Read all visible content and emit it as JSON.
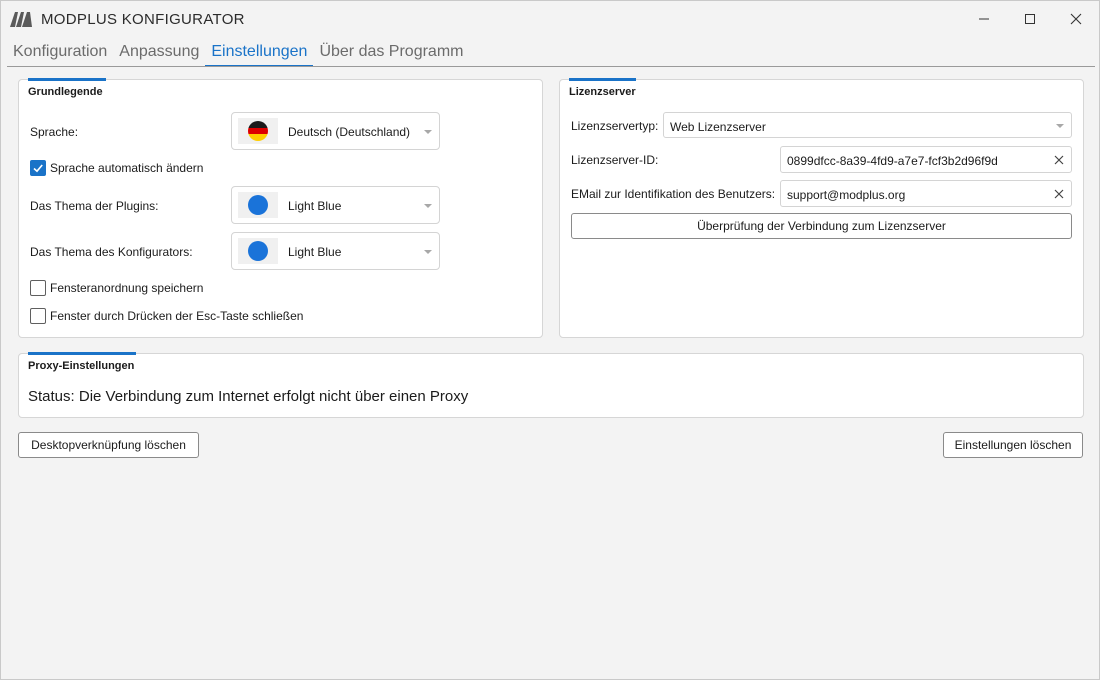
{
  "app": {
    "title": "MODPLUS KONFIGURATOR"
  },
  "tabs": [
    {
      "label": "Konfiguration"
    },
    {
      "label": "Anpassung"
    },
    {
      "label": "Einstellungen",
      "active": true
    },
    {
      "label": "Über das Programm"
    }
  ],
  "general": {
    "title": "Grundlegende",
    "language_label": "Sprache:",
    "language_value": "Deutsch (Deutschland)",
    "auto_language_label": "Sprache automatisch ändern",
    "auto_language_checked": true,
    "plugin_theme_label": "Das Thema der Plugins:",
    "plugin_theme_value": "Light Blue",
    "config_theme_label": "Das Thema des Konfigurators:",
    "config_theme_value": "Light Blue",
    "save_window_label": "Fensteranordnung speichern",
    "save_window_checked": false,
    "esc_close_label": "Fenster durch Drücken der Esc-Taste schließen",
    "esc_close_checked": false
  },
  "license": {
    "title": "Lizenzserver",
    "type_label": "Lizenzservertyp:",
    "type_value": "Web Lizenzserver",
    "id_label": "Lizenzserver-ID:",
    "id_value": "0899dfcc-8a39-4fd9-a7e7-fcf3b2d96f9d",
    "email_label": "EMail zur Identifikation des Benutzers:",
    "email_value": "support@modplus.org",
    "check_button": "Überprüfung der Verbindung zum Lizenzserver"
  },
  "proxy": {
    "title": "Proxy-Einstellungen",
    "status": "Status: Die Verbindung zum Internet erfolgt nicht über einen Proxy"
  },
  "footer": {
    "desktop_shortcut_button": "Desktopverknüpfung löschen",
    "delete_settings_button": "Einstellungen löschen"
  },
  "colors": {
    "accent": "#1a73c8",
    "theme_dot": "#1a73d9"
  },
  "icons": [
    "modplus-logo-icon",
    "minimize-icon",
    "maximize-icon",
    "close-icon",
    "germany-flag-icon",
    "checkmark-icon",
    "clear-icon",
    "chevron-down-icon"
  ]
}
